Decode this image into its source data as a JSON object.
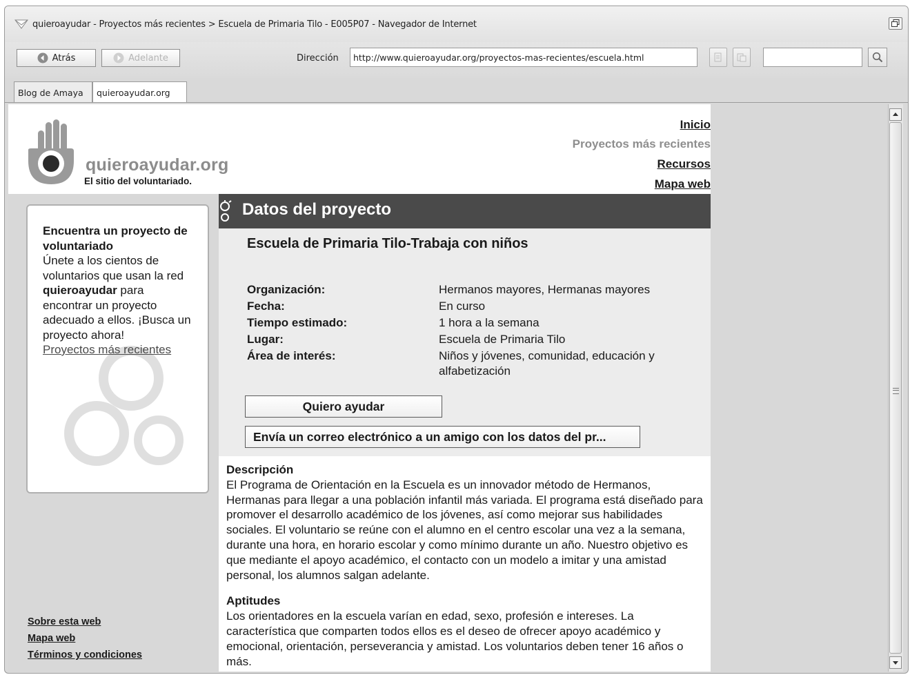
{
  "window": {
    "title": "quieroayudar - Proyectos más recientes > Escuela de Primaria Tilo - E005P07 - Navegador de Internet"
  },
  "toolbar": {
    "back_label": "Atrás",
    "forward_label": "Adelante",
    "address_label": "Dirección",
    "address_value": "http://www.quieroayudar.org/proyectos-mas-recientes/escuela.html",
    "search_value": ""
  },
  "tabs": [
    {
      "label": "Blog de Amaya",
      "active": false
    },
    {
      "label": "quieroayudar.org",
      "active": true
    }
  ],
  "site": {
    "logo_name": "quieroayudar.org",
    "tagline": "El sitio del voluntariado.",
    "nav": {
      "inicio": "Inicio",
      "recientes": "Proyectos más recientes",
      "recursos": "Recursos",
      "mapa": "Mapa web"
    }
  },
  "promo": {
    "title": "Encuentra un proyecto de voluntariado",
    "text_before": "Únete a los cientos de voluntarios que usan la red ",
    "brand": "quieroayudar",
    "text_after": " para encontrar un proyecto adecuado a ellos. ¡Busca un proyecto ahora!",
    "link": "Proyectos más recientes"
  },
  "footer_links": [
    "Sobre esta web",
    "Mapa web",
    "Términos y condiciones"
  ],
  "project": {
    "section_title": "Datos del proyecto",
    "title": "Escuela de Primaria Tilo-Trabaja con niños",
    "details": [
      {
        "label": "Organización:",
        "value": "Hermanos mayores, Hermanas mayores"
      },
      {
        "label": "Fecha:",
        "value": "En curso"
      },
      {
        "label": "Tiempo estimado:",
        "value": "1 hora a la semana"
      },
      {
        "label": "Lugar:",
        "value": "Escuela de Primaria Tilo"
      },
      {
        "label": "Área de interés:",
        "value": "Niños y jóvenes, comunidad, educación y alfabetización"
      }
    ],
    "help_button": "Quiero ayudar",
    "email_button": "Envía un correo electrónico a un amigo con los datos del pr...",
    "description_heading": "Descripción",
    "description": "El Programa de Orientación en la Escuela es un innovador método de Hermanos, Hermanas para llegar a una población infantil más variada. El programa está diseñado para promover el desarrollo académico de los jóvenes, así como mejorar sus habilidades sociales. El voluntario se reúne con el alumno en el centro escolar una vez a la semana, durante una hora, en horario escolar y como mínimo durante un año. Nuestro objetivo es que mediante el apoyo académico, el contacto con un modelo a imitar y una amistad personal, los alumnos salgan adelante.",
    "skills_heading": "Aptitudes",
    "skills": "Los orientadores en la escuela varían en edad, sexo, profesión e intereses. La característica que comparten todos ellos es el deseo de ofrecer apoyo académico y emocional, orientación, perseverancia y amistad. Los voluntarios deben tener 16 años o más."
  }
}
